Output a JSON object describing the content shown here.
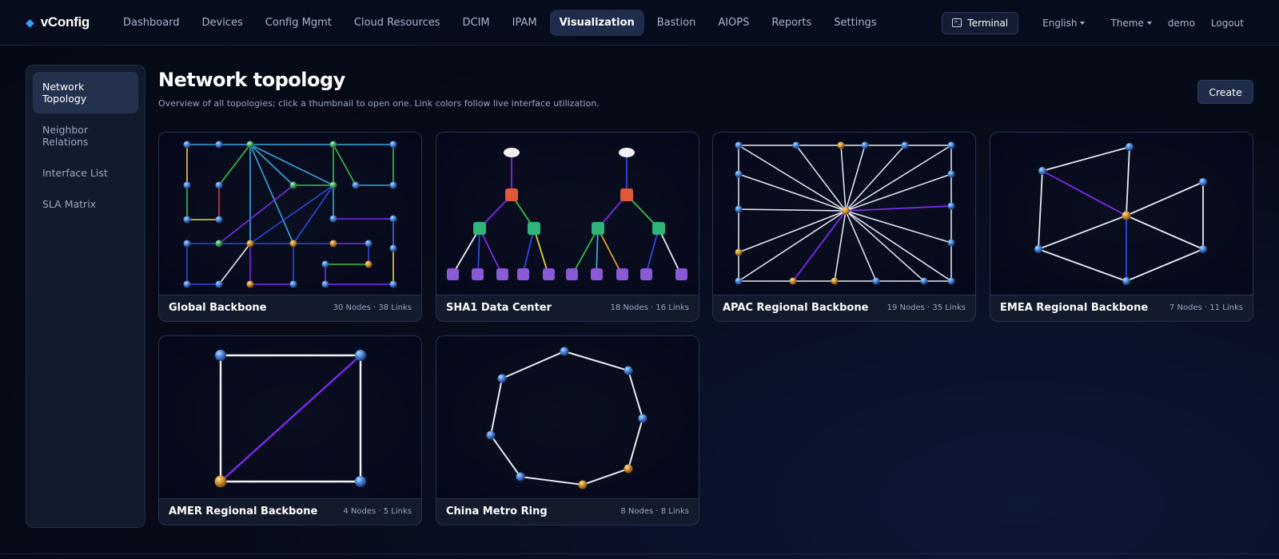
{
  "app": {
    "name": "vConfig",
    "icon": "diamond-icon"
  },
  "nav": {
    "items": [
      {
        "label": "Dashboard",
        "active": false
      },
      {
        "label": "Devices",
        "active": false
      },
      {
        "label": "Config Mgmt",
        "active": false
      },
      {
        "label": "Cloud Resources",
        "active": false
      },
      {
        "label": "DCIM",
        "active": false
      },
      {
        "label": "IPAM",
        "active": false
      },
      {
        "label": "Visualization",
        "active": true
      },
      {
        "label": "Bastion",
        "active": false
      },
      {
        "label": "AIOPS",
        "active": false
      },
      {
        "label": "Reports",
        "active": false
      },
      {
        "label": "Settings",
        "active": false
      }
    ],
    "terminal_label": "Terminal",
    "language": "English",
    "theme": "Theme",
    "user": "demo",
    "logout": "Logout"
  },
  "sidebar": {
    "items": [
      {
        "label": "Network Topology",
        "active": true
      },
      {
        "label": "Neighbor Relations",
        "active": false
      },
      {
        "label": "Interface List",
        "active": false
      },
      {
        "label": "SLA Matrix",
        "active": false
      }
    ]
  },
  "page": {
    "title": "Network topology",
    "subtitle": "Overview of all topologies; click a thumbnail to open one. Link colors follow live interface utilization.",
    "create_label": "Create"
  },
  "topologies": [
    {
      "name": "Global Backbone",
      "meta": "30 Nodes · 38 Links"
    },
    {
      "name": "SHA1 Data Center",
      "meta": "18 Nodes · 16 Links"
    },
    {
      "name": "APAC Regional Backbone",
      "meta": "19 Nodes · 35 Links"
    },
    {
      "name": "EMEA Regional Backbone",
      "meta": "7 Nodes · 11 Links"
    },
    {
      "name": "AMER Regional Backbone",
      "meta": "4 Nodes · 5 Links"
    },
    {
      "name": "China Metro Ring",
      "meta": "8 Nodes · 8 Links"
    }
  ],
  "colors": {
    "accent": "#3aa0ff",
    "link_white": "#e8ecf5",
    "link_purple": "#7b2cf0",
    "link_blue": "#2f49e0",
    "link_cyan": "#3aa6e0",
    "link_green": "#35c24a",
    "link_yellow": "#e8d23a",
    "link_red": "#e03a3a",
    "node_blue": "#3e7fd8",
    "node_orange": "#e0a03a",
    "node_green": "#4ab36a"
  }
}
